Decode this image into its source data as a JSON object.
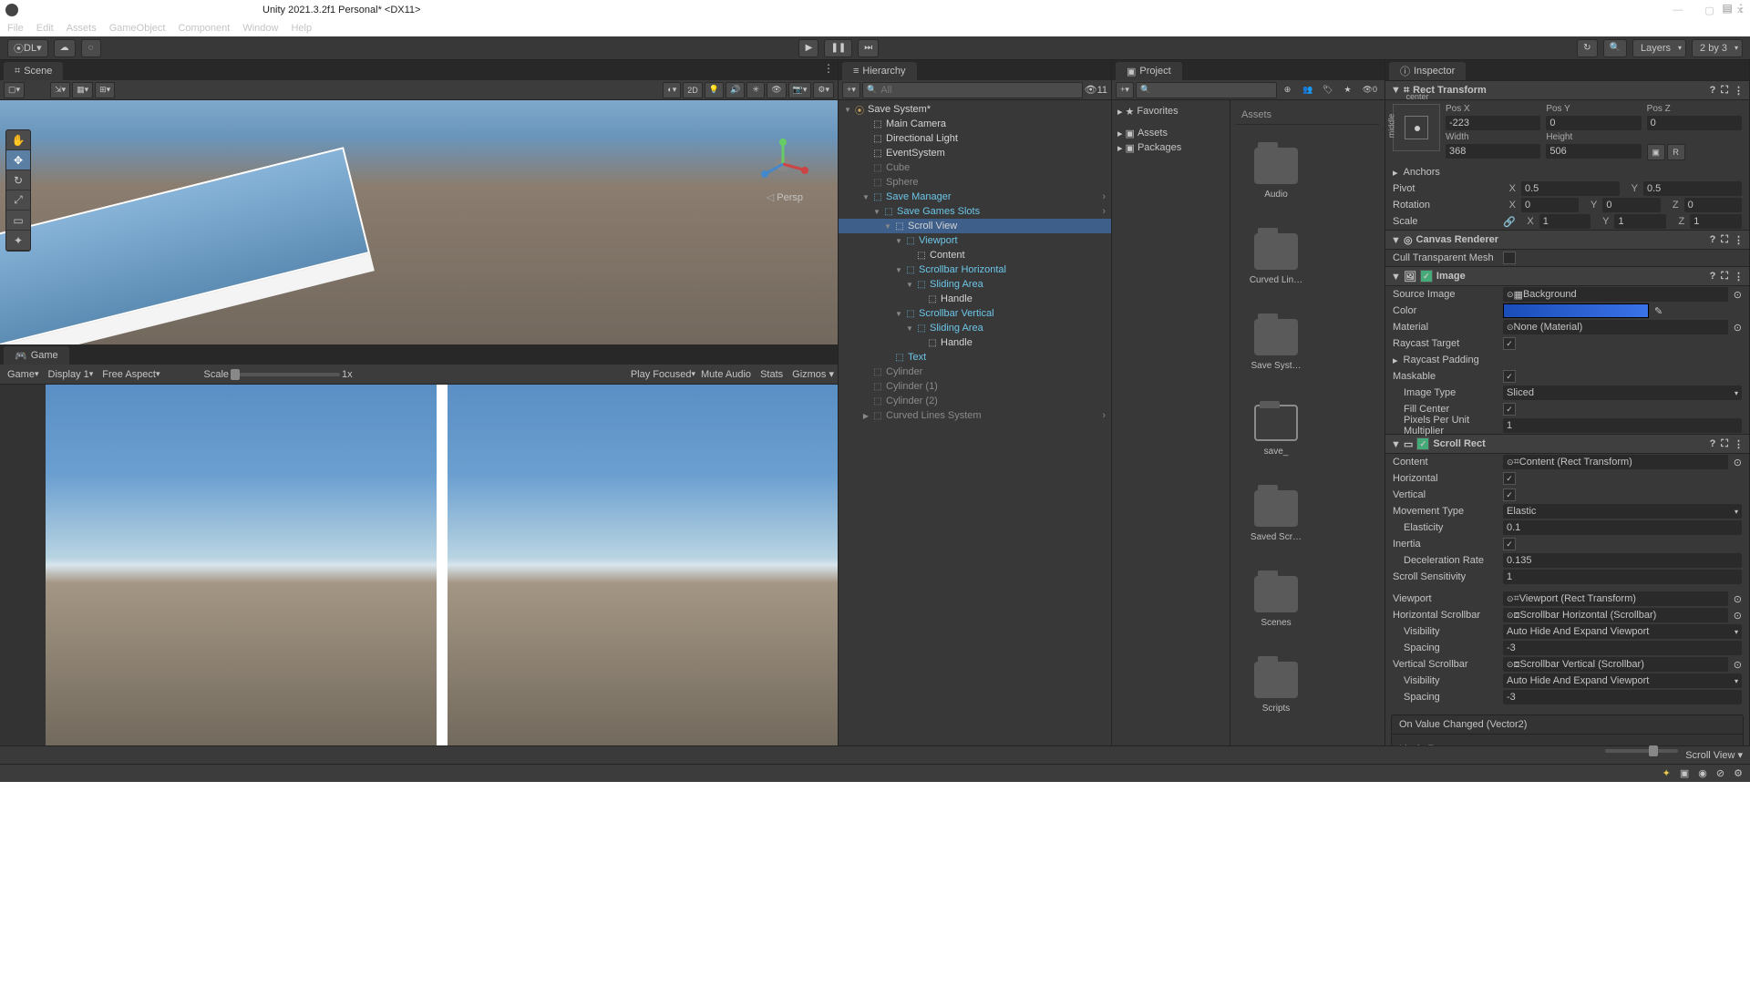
{
  "window": {
    "title": "Unity 2021.3.2f1 Personal* <DX11>",
    "account": "DL"
  },
  "menu": [
    "File",
    "Edit",
    "Assets",
    "GameObject",
    "Component",
    "Window",
    "Help"
  ],
  "toolbar_right": {
    "layers": "Layers",
    "layout": "2 by 3"
  },
  "scene": {
    "tab": "Scene",
    "btn_2d": "2D",
    "persp": "Persp"
  },
  "game": {
    "tab": "Game",
    "mode": "Game",
    "display": "Display 1",
    "aspect": "Free Aspect",
    "scale_lbl": "Scale",
    "scale_val": "1x",
    "focus": "Play Focused",
    "mute": "Mute Audio",
    "stats": "Stats",
    "gizmos": "Gizmos"
  },
  "hierarchy": {
    "tab": "Hierarchy",
    "search_ph": "All",
    "count": "11",
    "scene": "Save System*",
    "items": [
      {
        "name": "Main Camera",
        "cls": "c-white",
        "indent": 2
      },
      {
        "name": "Directional Light",
        "cls": "c-white",
        "indent": 2
      },
      {
        "name": "EventSystem",
        "cls": "c-white",
        "indent": 2
      },
      {
        "name": "Cube",
        "cls": "c-gray",
        "indent": 2
      },
      {
        "name": "Sphere",
        "cls": "c-gray",
        "indent": 2
      },
      {
        "name": "Save Manager",
        "cls": "c-cyan",
        "indent": 2,
        "arrow": "▼",
        "chev": ">"
      },
      {
        "name": "Save Games Slots",
        "cls": "c-cyan",
        "indent": 3,
        "arrow": "▼",
        "chev": ">"
      },
      {
        "name": "Scroll View",
        "cls": "c-white",
        "indent": 4,
        "arrow": "▼",
        "sel": true
      },
      {
        "name": "Viewport",
        "cls": "c-cyan",
        "indent": 5,
        "arrow": "▼"
      },
      {
        "name": "Content",
        "cls": "c-white",
        "indent": 6
      },
      {
        "name": "Scrollbar Horizontal",
        "cls": "c-cyan",
        "indent": 5,
        "arrow": "▼"
      },
      {
        "name": "Sliding Area",
        "cls": "c-cyan",
        "indent": 6,
        "arrow": "▼"
      },
      {
        "name": "Handle",
        "cls": "c-white",
        "indent": 7
      },
      {
        "name": "Scrollbar Vertical",
        "cls": "c-cyan",
        "indent": 5,
        "arrow": "▼"
      },
      {
        "name": "Sliding Area",
        "cls": "c-cyan",
        "indent": 6,
        "arrow": "▼"
      },
      {
        "name": "Handle",
        "cls": "c-white",
        "indent": 7
      },
      {
        "name": "Text",
        "cls": "c-cyan",
        "indent": 4
      },
      {
        "name": "Cylinder",
        "cls": "c-gray",
        "indent": 2
      },
      {
        "name": "Cylinder (1)",
        "cls": "c-gray",
        "indent": 2
      },
      {
        "name": "Cylinder (2)",
        "cls": "c-gray",
        "indent": 2
      },
      {
        "name": "Curved Lines System",
        "cls": "c-gray",
        "indent": 2,
        "arrow": "▶",
        "chev": ">"
      }
    ]
  },
  "project": {
    "tab": "Project",
    "favorites": "Favorites",
    "assets_hdr": "Assets",
    "tree": [
      "Assets",
      "Packages"
    ],
    "items": [
      "Audio",
      "Curved Lin…",
      "Save Syst…",
      "save_",
      "Saved Scr…",
      "Scenes",
      "Scripts"
    ]
  },
  "inspector": {
    "tab": "Inspector",
    "rt": {
      "title": "Rect Transform",
      "anchor_preset_t": "center",
      "anchor_preset_s": "middle",
      "posx_l": "Pos X",
      "posx": "-223",
      "posy_l": "Pos Y",
      "posy": "0",
      "posz_l": "Pos Z",
      "posz": "0",
      "w_l": "Width",
      "w": "368",
      "h_l": "Height",
      "h": "506",
      "anchors": "Anchors",
      "pivot": "Pivot",
      "pivot_x": "0.5",
      "pivot_y": "0.5",
      "rotation": "Rotation",
      "rx": "0",
      "ry": "0",
      "rz": "0",
      "scale": "Scale",
      "sx": "1",
      "sy": "1",
      "sz": "1"
    },
    "cr": {
      "title": "Canvas Renderer",
      "cull": "Cull Transparent Mesh"
    },
    "img": {
      "title": "Image",
      "source": "Source Image",
      "source_v": "Background",
      "color": "Color",
      "material": "Material",
      "material_v": "None (Material)",
      "raycast": "Raycast Target",
      "raypad": "Raycast Padding",
      "mask": "Maskable",
      "type": "Image Type",
      "type_v": "Sliced",
      "fill": "Fill Center",
      "ppu": "Pixels Per Unit Multiplier",
      "ppu_v": "1"
    },
    "sr": {
      "title": "Scroll Rect",
      "content": "Content",
      "content_v": "Content (Rect Transform)",
      "horiz": "Horizontal",
      "vert": "Vertical",
      "movetype": "Movement Type",
      "movetype_v": "Elastic",
      "elasticity": "Elasticity",
      "elasticity_v": "0.1",
      "inertia": "Inertia",
      "decel": "Deceleration Rate",
      "decel_v": "0.135",
      "sens": "Scroll Sensitivity",
      "sens_v": "1",
      "viewport": "Viewport",
      "viewport_v": "Viewport (Rect Transform)",
      "hsb": "Horizontal Scrollbar",
      "hsb_v": "Scrollbar Horizontal (Scrollbar)",
      "vis": "Visibility",
      "vis_v": "Auto Hide And Expand Viewport",
      "spacing": "Spacing",
      "spacing_v": "-3",
      "vsb": "Vertical Scrollbar",
      "vsb_v": "Scrollbar Vertical (Scrollbar)",
      "event": "On Value Changed (Vector2)",
      "empty": "List is Empty"
    },
    "footer": "Scroll View"
  }
}
